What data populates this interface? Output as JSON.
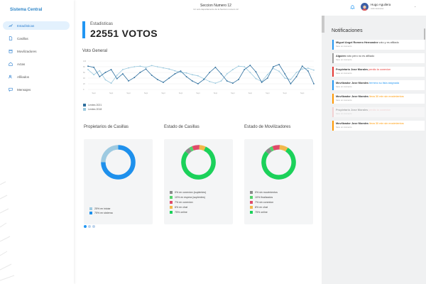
{
  "app": {
    "brand": "Sistema Central"
  },
  "sidebar": {
    "items": [
      {
        "label": "Estadísticas",
        "icon": "trending-up-icon",
        "active": true
      },
      {
        "label": "Casillas",
        "icon": "file-icon",
        "active": false
      },
      {
        "label": "Movilizadores",
        "icon": "calendar-icon",
        "active": false
      },
      {
        "label": "Actas",
        "icon": "home-icon",
        "active": false
      },
      {
        "label": "Afiliados",
        "icon": "users-icon",
        "active": false
      },
      {
        "label": "Mensajes",
        "icon": "message-icon",
        "active": false
      }
    ]
  },
  "topbar": {
    "section_title": "Seccion Numero 12",
    "section_sub": "Un solo departamento de la Seccion numero 12",
    "user_name": "Hugo Aguilera",
    "user_role": "Administrador"
  },
  "stats": {
    "label": "Estadisticas",
    "value": "22551 VOTOS"
  },
  "line_chart": {
    "title": "Voto General",
    "legend": [
      "Lentes 2021",
      "Lentes 2018"
    ]
  },
  "chart_data": [
    {
      "type": "line",
      "title": "Voto General",
      "x": [
        "Sept",
        "Sept",
        "Sept",
        "Sept",
        "Sept",
        "Sept",
        "Sept",
        "Sept",
        "Sept",
        "Sept",
        "Sept",
        "Sept",
        "Sept",
        "Sept",
        "Sept",
        "Sept",
        "Sept",
        "Sept",
        "Sept",
        "Sept",
        "Sept",
        "Sept",
        "Sept",
        "Sept",
        "Sept",
        "Sept",
        "Sept",
        "Sept",
        "Sept",
        "Sept",
        "Sept",
        "Sept",
        "Sept",
        "Sept",
        "Sept",
        "Sept",
        "Sept",
        "Sept",
        "Sept",
        "Sept"
      ],
      "ylim": [
        0,
        100
      ],
      "yticks": [
        0,
        20,
        40,
        60,
        80,
        100
      ],
      "series": [
        {
          "name": "Lentes 2021",
          "color": "#2e6f9e",
          "values": [
            82,
            78,
            45,
            60,
            70,
            38,
            55,
            30,
            42,
            60,
            72,
            50,
            35,
            25,
            40,
            55,
            65,
            45,
            30,
            20,
            35,
            60,
            78,
            55,
            30,
            22,
            35,
            70,
            85,
            62,
            25,
            40,
            80,
            88,
            55,
            20,
            45,
            82,
            65,
            20
          ]
        },
        {
          "name": "Lentes 2018",
          "color": "#9cc9de",
          "values": [
            70,
            52,
            66,
            34,
            22,
            50,
            70,
            76,
            80,
            82,
            78,
            84,
            80,
            76,
            72,
            66,
            60,
            58,
            52,
            48,
            38,
            28,
            22,
            30,
            55,
            70,
            82,
            80,
            60,
            38,
            28,
            52,
            74,
            64,
            40,
            35,
            60,
            72,
            75,
            68
          ]
        }
      ]
    },
    {
      "type": "pie",
      "title": "Propietarios de Casillas",
      "categories": [
        "25% en iniciar",
        "75% en sistema"
      ],
      "values": [
        25,
        75
      ],
      "colors": [
        "#9ecae1",
        "#1e90ec"
      ]
    },
    {
      "type": "pie",
      "title": "Estado de Casillas",
      "categories": [
        "0% en conexion (suplentes)",
        "10% en espera (suplentes)",
        "7% en conexion",
        "6% en chat",
        "75% online"
      ],
      "values": [
        5,
        3,
        7,
        6,
        79
      ],
      "colors": [
        "#8a8a8a",
        "#52d46a",
        "#e04a6a",
        "#f2b84b",
        "#1bd15a"
      ]
    },
    {
      "type": "pie",
      "title": "Estado de Movilizadores",
      "categories": [
        "0% sin movimientos",
        "10% finalizados",
        "7% sin conexion",
        "8% en chat",
        "75% online"
      ],
      "values": [
        5,
        3,
        7,
        8,
        77
      ],
      "colors": [
        "#8a8a8a",
        "#52d46a",
        "#e04a6a",
        "#f2b84b",
        "#1bd15a"
      ]
    }
  ],
  "cards": [
    {
      "title": "Propietarios de Casillas",
      "legend": [
        "25% en iniciar",
        "75% en sistema"
      ]
    },
    {
      "title": "Estado de Casillas",
      "legend": [
        "0% en conexion (suplentes)",
        "10% en espera (suplentes)",
        "7% en conexion",
        "6% en chat",
        "75% online"
      ]
    },
    {
      "title": "Estado de Movilizadores",
      "legend": [
        "0% sin movimientos",
        "10% finalizados",
        "7% sin conexion",
        "8% en chat",
        "75% online"
      ]
    }
  ],
  "notifications": {
    "title": "Notificaciones",
    "items": [
      {
        "who": "Miguel Angel Romero Hernandez",
        "text": " voto y es afiliado",
        "highlight": "",
        "time": "hace un momento",
        "color": "#2196f3",
        "faded": false
      },
      {
        "who": "Alguien",
        "text": " voto pero no es afiliado",
        "highlight": "",
        "time": "hace un momento",
        "color": "#9e9e9e",
        "faded": false
      },
      {
        "who": "Propietario Jose Morales",
        "text": " ",
        "highlight": "perdio la conexion",
        "time": "hace un momento",
        "color": "#e53935",
        "faded": false
      },
      {
        "who": "Movilizador Jose Morales",
        "text": " ",
        "highlight": "termino su lista asignada",
        "time": "hace un momento",
        "color": "#2196f3",
        "faded": false
      },
      {
        "who": "Movilizador Jose Morales",
        "text": " ",
        "highlight": "lleva 30 min sin movimientos",
        "time": "hace un momento",
        "color": "#ff9800",
        "faded": false
      },
      {
        "who": "Propietario Jose Morales",
        "text": " ",
        "highlight": "perdio la conexion",
        "time": "hace un momento",
        "color": "#f3a6a6",
        "faded": true
      },
      {
        "who": "Movilizador Jose Morales",
        "text": " ",
        "highlight": "lleva 30 min sin movimientos",
        "time": "hace un momento",
        "color": "#ff9800",
        "faded": false
      }
    ]
  }
}
